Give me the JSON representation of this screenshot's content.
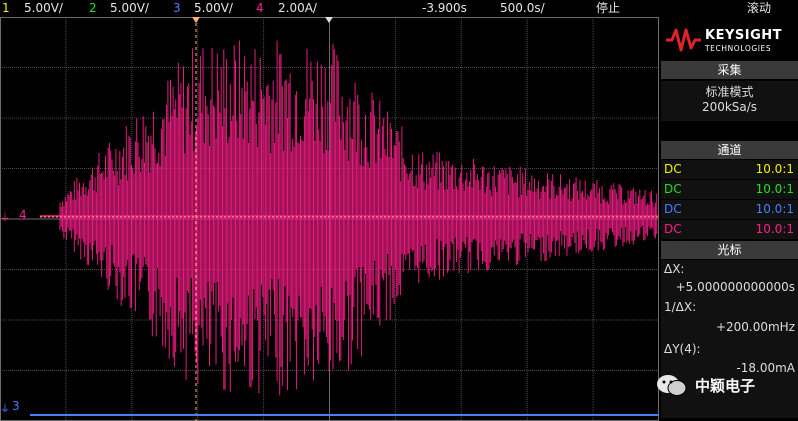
{
  "topbar": {
    "ch1_num": "1",
    "ch1_scale": "5.00V/",
    "ch2_num": "2",
    "ch2_scale": "5.00V/",
    "ch3_num": "3",
    "ch3_scale": "5.00V/",
    "ch4_num": "4",
    "ch4_scale": "2.00A/",
    "time_offset": "-3.900s",
    "time_scale": "500.0s/",
    "run_state": "停止",
    "right_label": "滚动"
  },
  "colors": {
    "ch1": "#f2f200",
    "ch2": "#22e022",
    "ch3": "#4a7dff",
    "ch4": "#ff1e8c",
    "cursor": "#ffb070",
    "grid": "#4d4d4d"
  },
  "markers": {
    "ch4_label": "4",
    "ch3_label": "3"
  },
  "brand": {
    "name": "KEYSIGHT",
    "sub": "TECHNOLOGIES"
  },
  "acquisition": {
    "title": "采集",
    "mode": "标准模式",
    "rate": "200kSa/s"
  },
  "channels": {
    "title": "通道",
    "rows": [
      {
        "coupling": "DC",
        "ratio": "10.0:1"
      },
      {
        "coupling": "DC",
        "ratio": "10.0:1"
      },
      {
        "coupling": "DC",
        "ratio": "10.0:1"
      },
      {
        "coupling": "DC",
        "ratio": "10.0:1"
      }
    ]
  },
  "cursors": {
    "title": "光标",
    "dx_label": "ΔX:",
    "dx_value": "+5.000000000000s",
    "inv_label": "1/ΔX:",
    "inv_value": "+200.00mHz",
    "dy_label": "ΔY(4):",
    "dy_value": "-18.00mA"
  },
  "watermark": {
    "text": "中颖电子",
    "icon": "wechat-icon"
  }
}
